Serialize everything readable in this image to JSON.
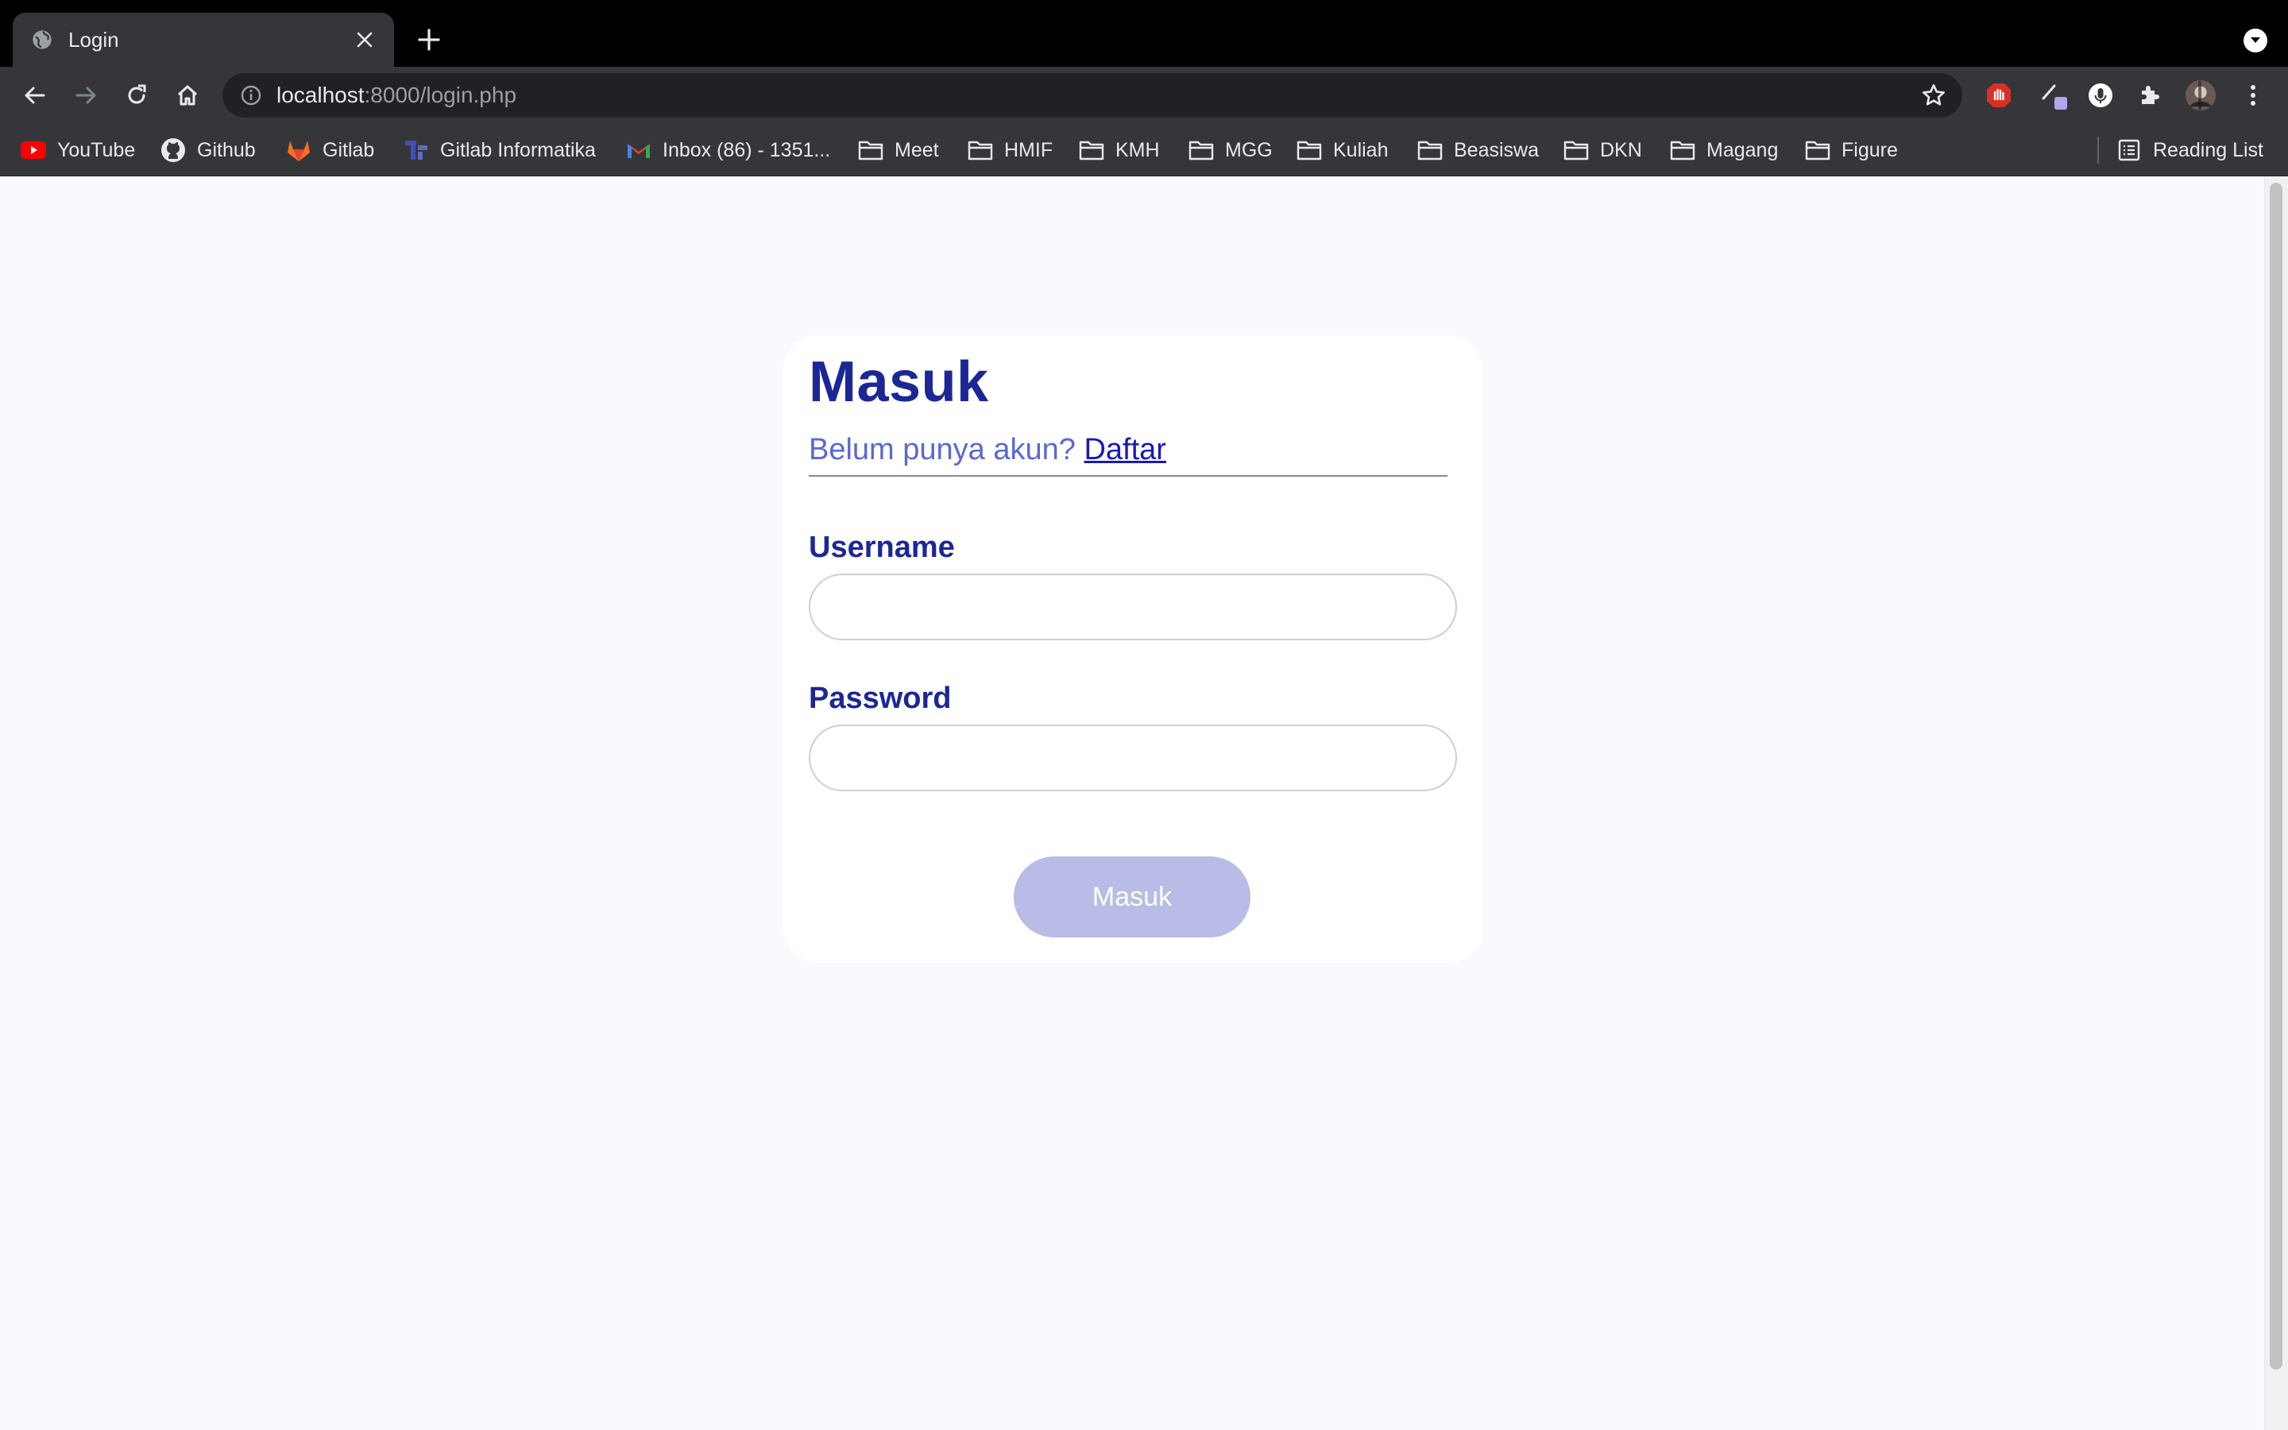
{
  "browser": {
    "tab": {
      "title": "Login"
    },
    "address": {
      "host": "localhost",
      "rest": ":8000/login.php"
    },
    "bookmarks": [
      {
        "label": "YouTube",
        "icon": "youtube-icon"
      },
      {
        "label": "Github",
        "icon": "github-icon"
      },
      {
        "label": "Gitlab",
        "icon": "gitlab-icon"
      },
      {
        "label": "Gitlab Informatika",
        "icon": "gitlab-informatika-icon"
      },
      {
        "label": "Inbox (86) - 1351...",
        "icon": "gmail-icon"
      },
      {
        "label": "Meet",
        "icon": "folder-icon"
      },
      {
        "label": "HMIF",
        "icon": "folder-icon"
      },
      {
        "label": "KMH",
        "icon": "folder-icon"
      },
      {
        "label": "MGG",
        "icon": "folder-icon"
      },
      {
        "label": "Kuliah",
        "icon": "folder-icon"
      },
      {
        "label": "Beasiswa",
        "icon": "folder-icon"
      },
      {
        "label": "DKN",
        "icon": "folder-icon"
      },
      {
        "label": "Magang",
        "icon": "folder-icon"
      },
      {
        "label": "Figure",
        "icon": "folder-icon"
      }
    ],
    "reading_list": "Reading List"
  },
  "page": {
    "title": "Masuk",
    "signup_prompt": "Belum punya akun?",
    "signup_link": "Daftar",
    "username_label": "Username",
    "username_value": "",
    "password_label": "Password",
    "password_value": "",
    "submit_label": "Masuk",
    "colors": {
      "heading": "#1c2796",
      "prompt": "#5a68d6",
      "link": "#1a1ab5",
      "button": "#b8bce6",
      "background": "#f9fafe"
    }
  }
}
